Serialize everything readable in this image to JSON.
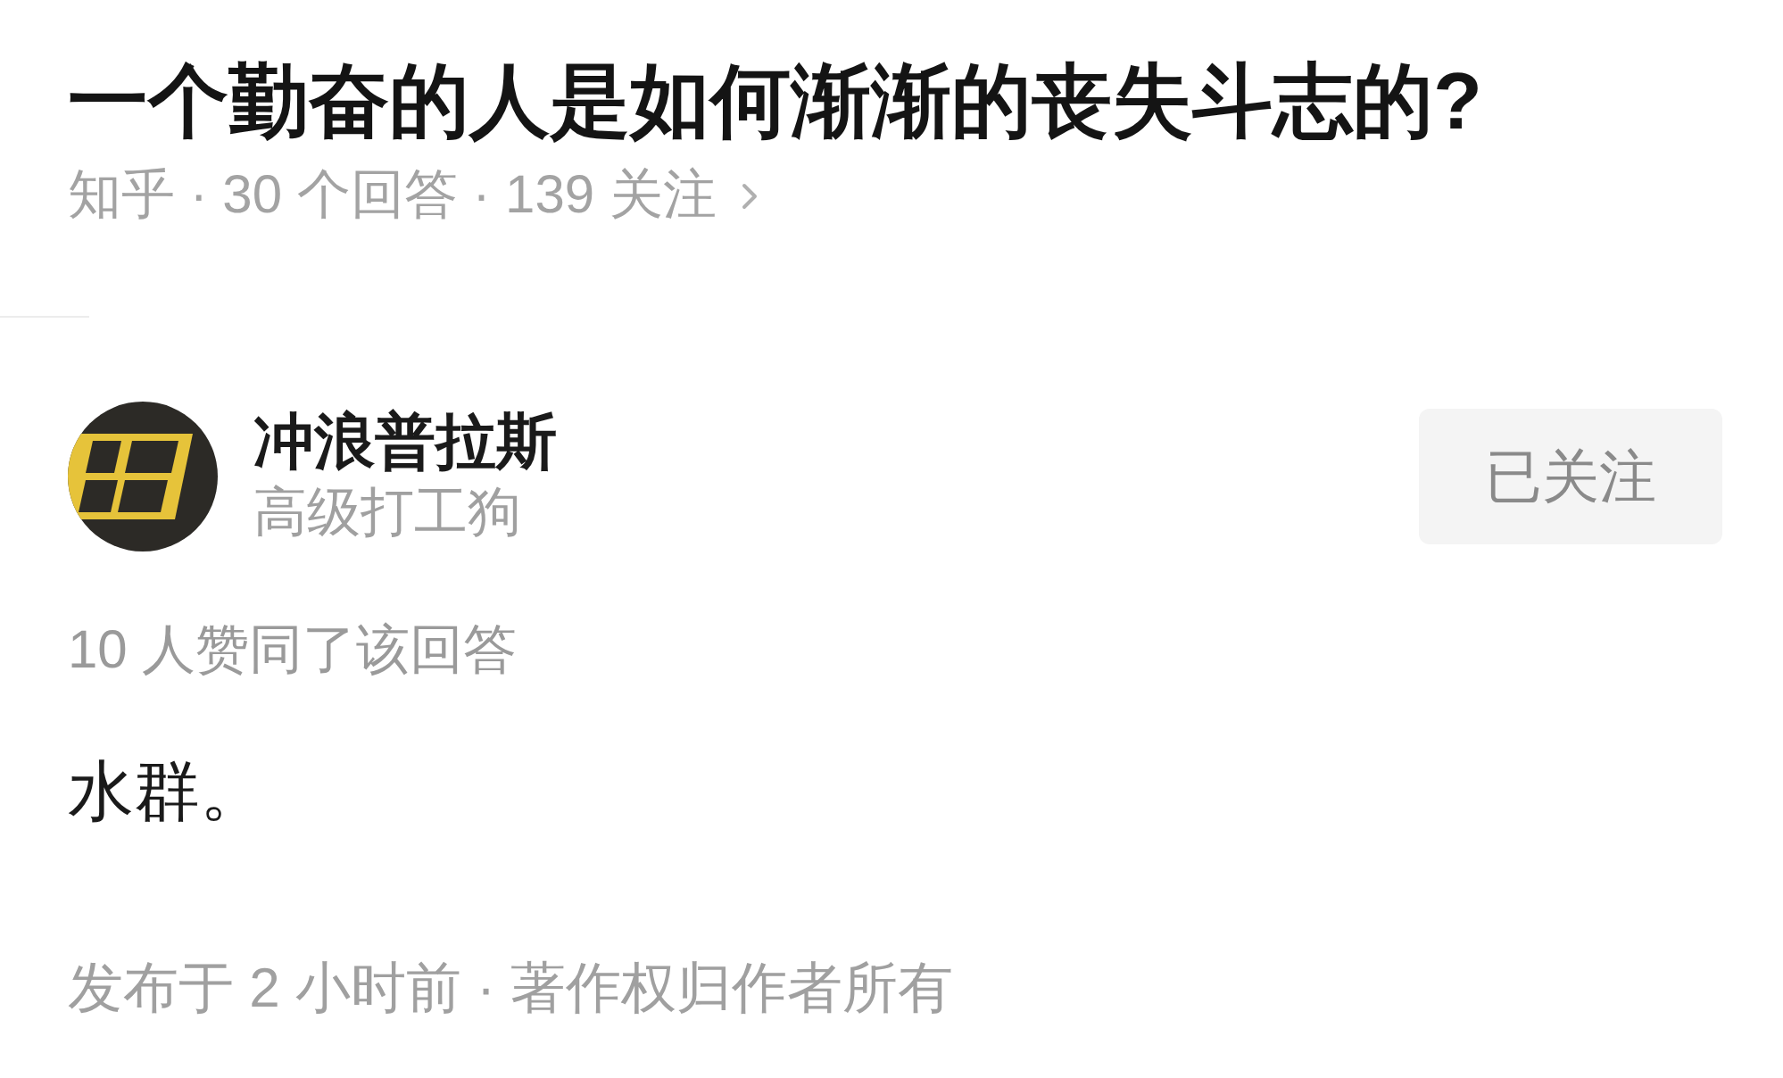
{
  "question": {
    "title": "一个勤奋的人是如何渐渐的丧失斗志的?",
    "meta": "知乎 · 30 个回答 · 139 关注"
  },
  "answer": {
    "author": {
      "name": "冲浪普拉斯",
      "bio": "高级打工狗"
    },
    "follow_button": {
      "label": "已关注",
      "followed": true
    },
    "votes": "10 人赞同了该回答",
    "content": "水群。",
    "footer": "发布于 2 小时前 · 著作权归作者所有"
  }
}
